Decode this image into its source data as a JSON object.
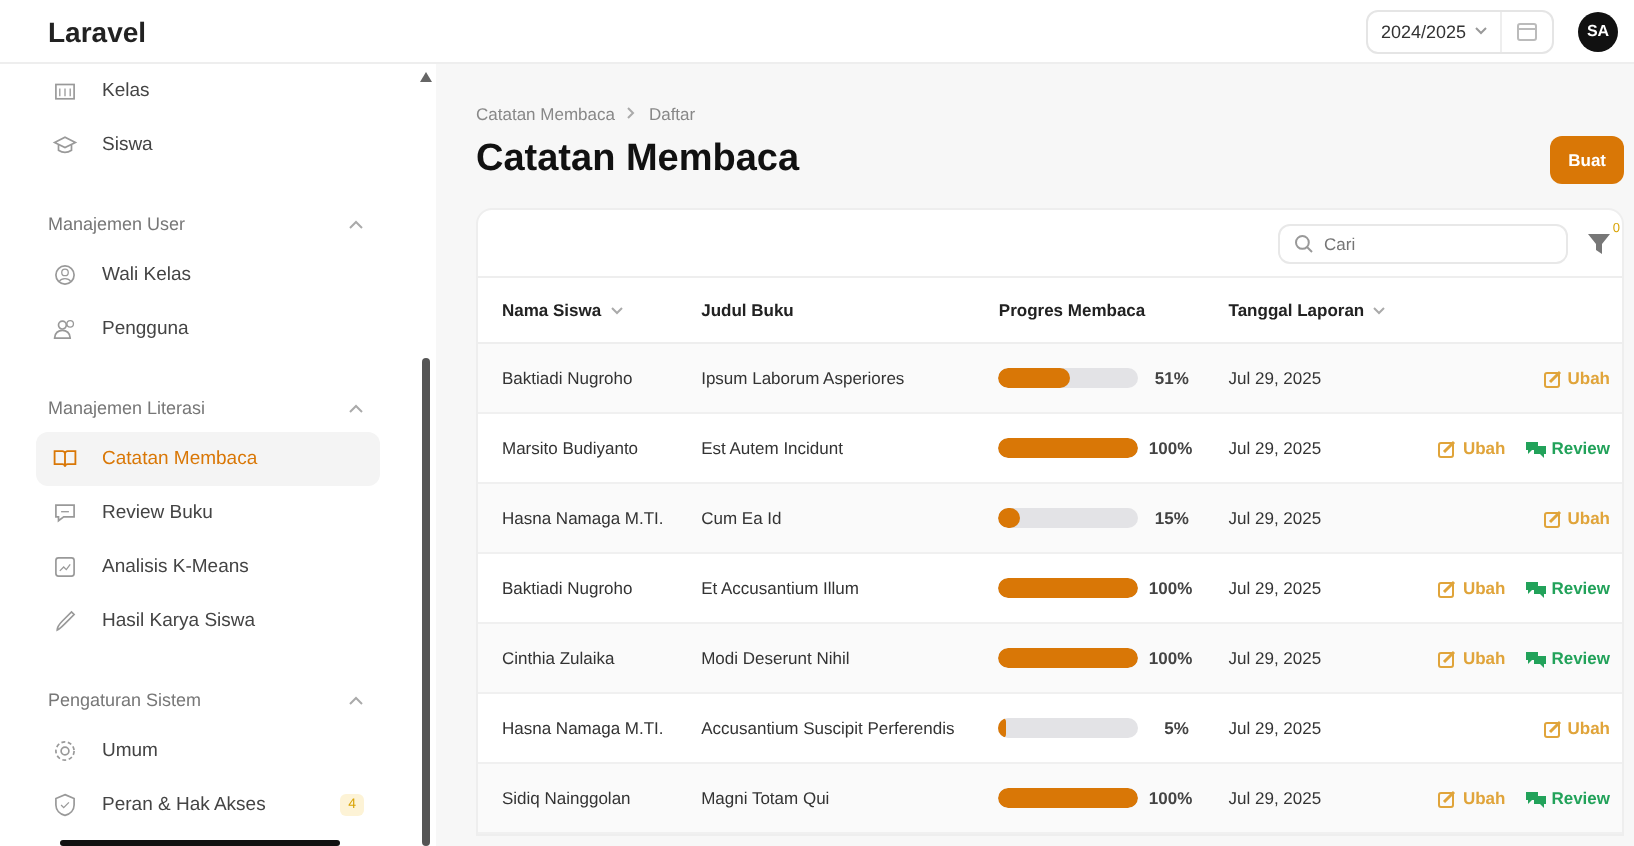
{
  "app": {
    "title": "Laravel",
    "year": "2024/2025",
    "avatar": "SA"
  },
  "sidebar": {
    "top_items": [
      {
        "label": "Kelas",
        "selected": false
      },
      {
        "label": "Siswa",
        "selected": false
      }
    ],
    "groups": [
      {
        "title": "Manajemen User",
        "expanded": true,
        "items": [
          {
            "label": "Wali Kelas",
            "selected": false
          },
          {
            "label": "Pengguna",
            "selected": false
          }
        ]
      },
      {
        "title": "Manajemen Literasi",
        "expanded": true,
        "items": [
          {
            "label": "Catatan Membaca",
            "selected": true
          },
          {
            "label": "Review Buku",
            "selected": false
          },
          {
            "label": "Analisis K-Means",
            "selected": false
          },
          {
            "label": "Hasil Karya Siswa",
            "selected": false
          }
        ]
      },
      {
        "title": "Pengaturan Sistem",
        "expanded": true,
        "items": [
          {
            "label": "Umum",
            "selected": false
          },
          {
            "label": "Peran & Hak Akses",
            "selected": false,
            "badge": "4"
          }
        ]
      }
    ]
  },
  "breadcrumb": [
    "Catatan Membaca",
    "Daftar"
  ],
  "page_title": "Catatan Membaca",
  "create_button": "Buat",
  "search": {
    "placeholder": "Cari"
  },
  "filter_count": "0",
  "table": {
    "columns": [
      {
        "label": "Nama Siswa",
        "sortable": true
      },
      {
        "label": "Judul Buku",
        "sortable": false
      },
      {
        "label": "Progres Membaca",
        "sortable": false
      },
      {
        "label": "Tanggal Laporan",
        "sortable": true
      }
    ],
    "rows": [
      {
        "name": "Baktiadi Nugroho",
        "book": "Ipsum Laborum Asperiores",
        "level": 0.51,
        "percent": "51%",
        "date": "Jul 29, 2025",
        "actions": [
          {
            "kind": "edit",
            "label": "Ubah"
          }
        ]
      },
      {
        "name": "Marsito Budiyanto",
        "book": "Est Autem Incidunt",
        "level": 1,
        "percent": "100%",
        "date": "Jul 29, 2025",
        "actions": [
          {
            "kind": "edit",
            "label": "Ubah"
          },
          {
            "kind": "review",
            "label": "Review"
          }
        ]
      },
      {
        "name": "Hasna Namaga M.TI.",
        "book": "Cum Ea Id",
        "level": 0.15,
        "percent": "15%",
        "date": "Jul 29, 2025",
        "actions": [
          {
            "kind": "edit",
            "label": "Ubah"
          }
        ]
      },
      {
        "name": "Baktiadi Nugroho",
        "book": "Et Accusantium Illum",
        "level": 1,
        "percent": "100%",
        "date": "Jul 29, 2025",
        "actions": [
          {
            "kind": "edit",
            "label": "Ubah"
          },
          {
            "kind": "review",
            "label": "Review"
          }
        ]
      },
      {
        "name": "Cinthia Zulaika",
        "book": "Modi Deserunt Nihil",
        "level": 1,
        "percent": "100%",
        "date": "Jul 29, 2025",
        "actions": [
          {
            "kind": "edit",
            "label": "Ubah"
          },
          {
            "kind": "review",
            "label": "Review"
          }
        ]
      },
      {
        "name": "Hasna Namaga M.TI.",
        "book": "Accusantium Suscipit Perferendis",
        "level": 0.05,
        "percent": "5%",
        "date": "Jul 29, 2025",
        "actions": [
          {
            "kind": "edit",
            "label": "Ubah"
          }
        ]
      },
      {
        "name": "Sidiq Nainggolan",
        "book": "Magni Totam Qui",
        "level": 1,
        "percent": "100%",
        "date": "Jul 29, 2025",
        "actions": [
          {
            "kind": "edit",
            "label": "Ubah"
          },
          {
            "kind": "review",
            "label": "Review"
          }
        ]
      }
    ]
  }
}
